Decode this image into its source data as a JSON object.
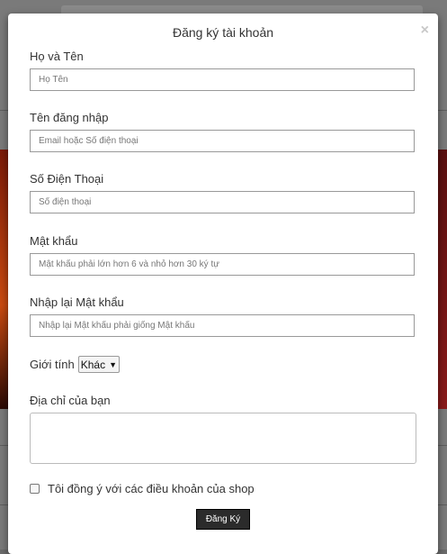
{
  "modal": {
    "title": "Đăng ký tài khoản",
    "close_symbol": "×"
  },
  "form": {
    "fullname": {
      "label": "Họ và Tên",
      "placeholder": "Họ Tên"
    },
    "username": {
      "label": "Tên đăng nhập",
      "placeholder": "Email hoặc Số điện thoại"
    },
    "phone": {
      "label": "Số Điện Thoại",
      "placeholder": "Số điện thoại"
    },
    "password": {
      "label": "Mật khẩu",
      "placeholder": "Mật khẩu phải lớn hơn 6 và nhỏ hơn 30 ký tự"
    },
    "confirm_password": {
      "label": "Nhập lại Mật khẩu",
      "placeholder": "Nhập lại Mật khẩu phải giống Mật khẩu"
    },
    "gender": {
      "label": "Giới tính",
      "selected": "Khác"
    },
    "address": {
      "label": "Địa chỉ của bạn"
    },
    "agree": {
      "label": "Tôi đồng ý với các điều khoản của shop"
    },
    "submit_label": "Đăng Ký"
  }
}
